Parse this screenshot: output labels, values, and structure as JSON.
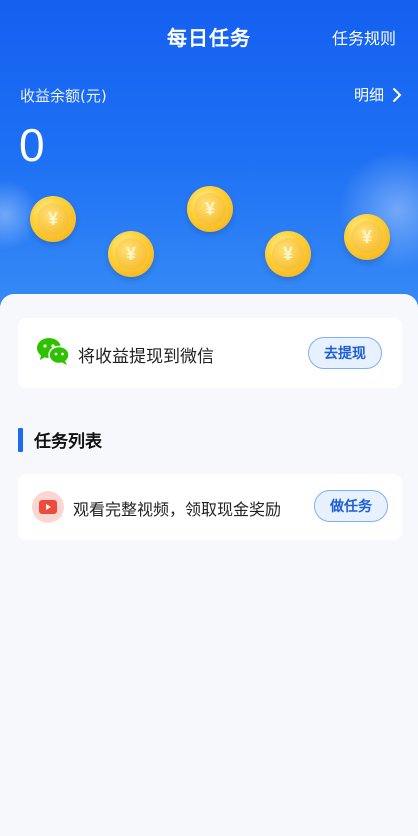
{
  "header": {
    "title": "每日任务",
    "rules_link": "任务规则",
    "balance_label": "收益余额(元)",
    "detail_link": "明细",
    "balance_value": "0",
    "coin_symbol": "¥"
  },
  "withdraw": {
    "text": "将收益提现到微信",
    "button": "去提现",
    "icon": "wechat-icon"
  },
  "tasks": {
    "section_title": "任务列表",
    "items": [
      {
        "text": "观看完整视频，领取现金奖励",
        "button": "做任务",
        "icon": "video-play-icon"
      }
    ]
  },
  "colors": {
    "header_blue": "#1460f0",
    "accent": "#1f6bf0",
    "coin_gold": "#ffd23a",
    "wechat_green": "#2dc100"
  }
}
